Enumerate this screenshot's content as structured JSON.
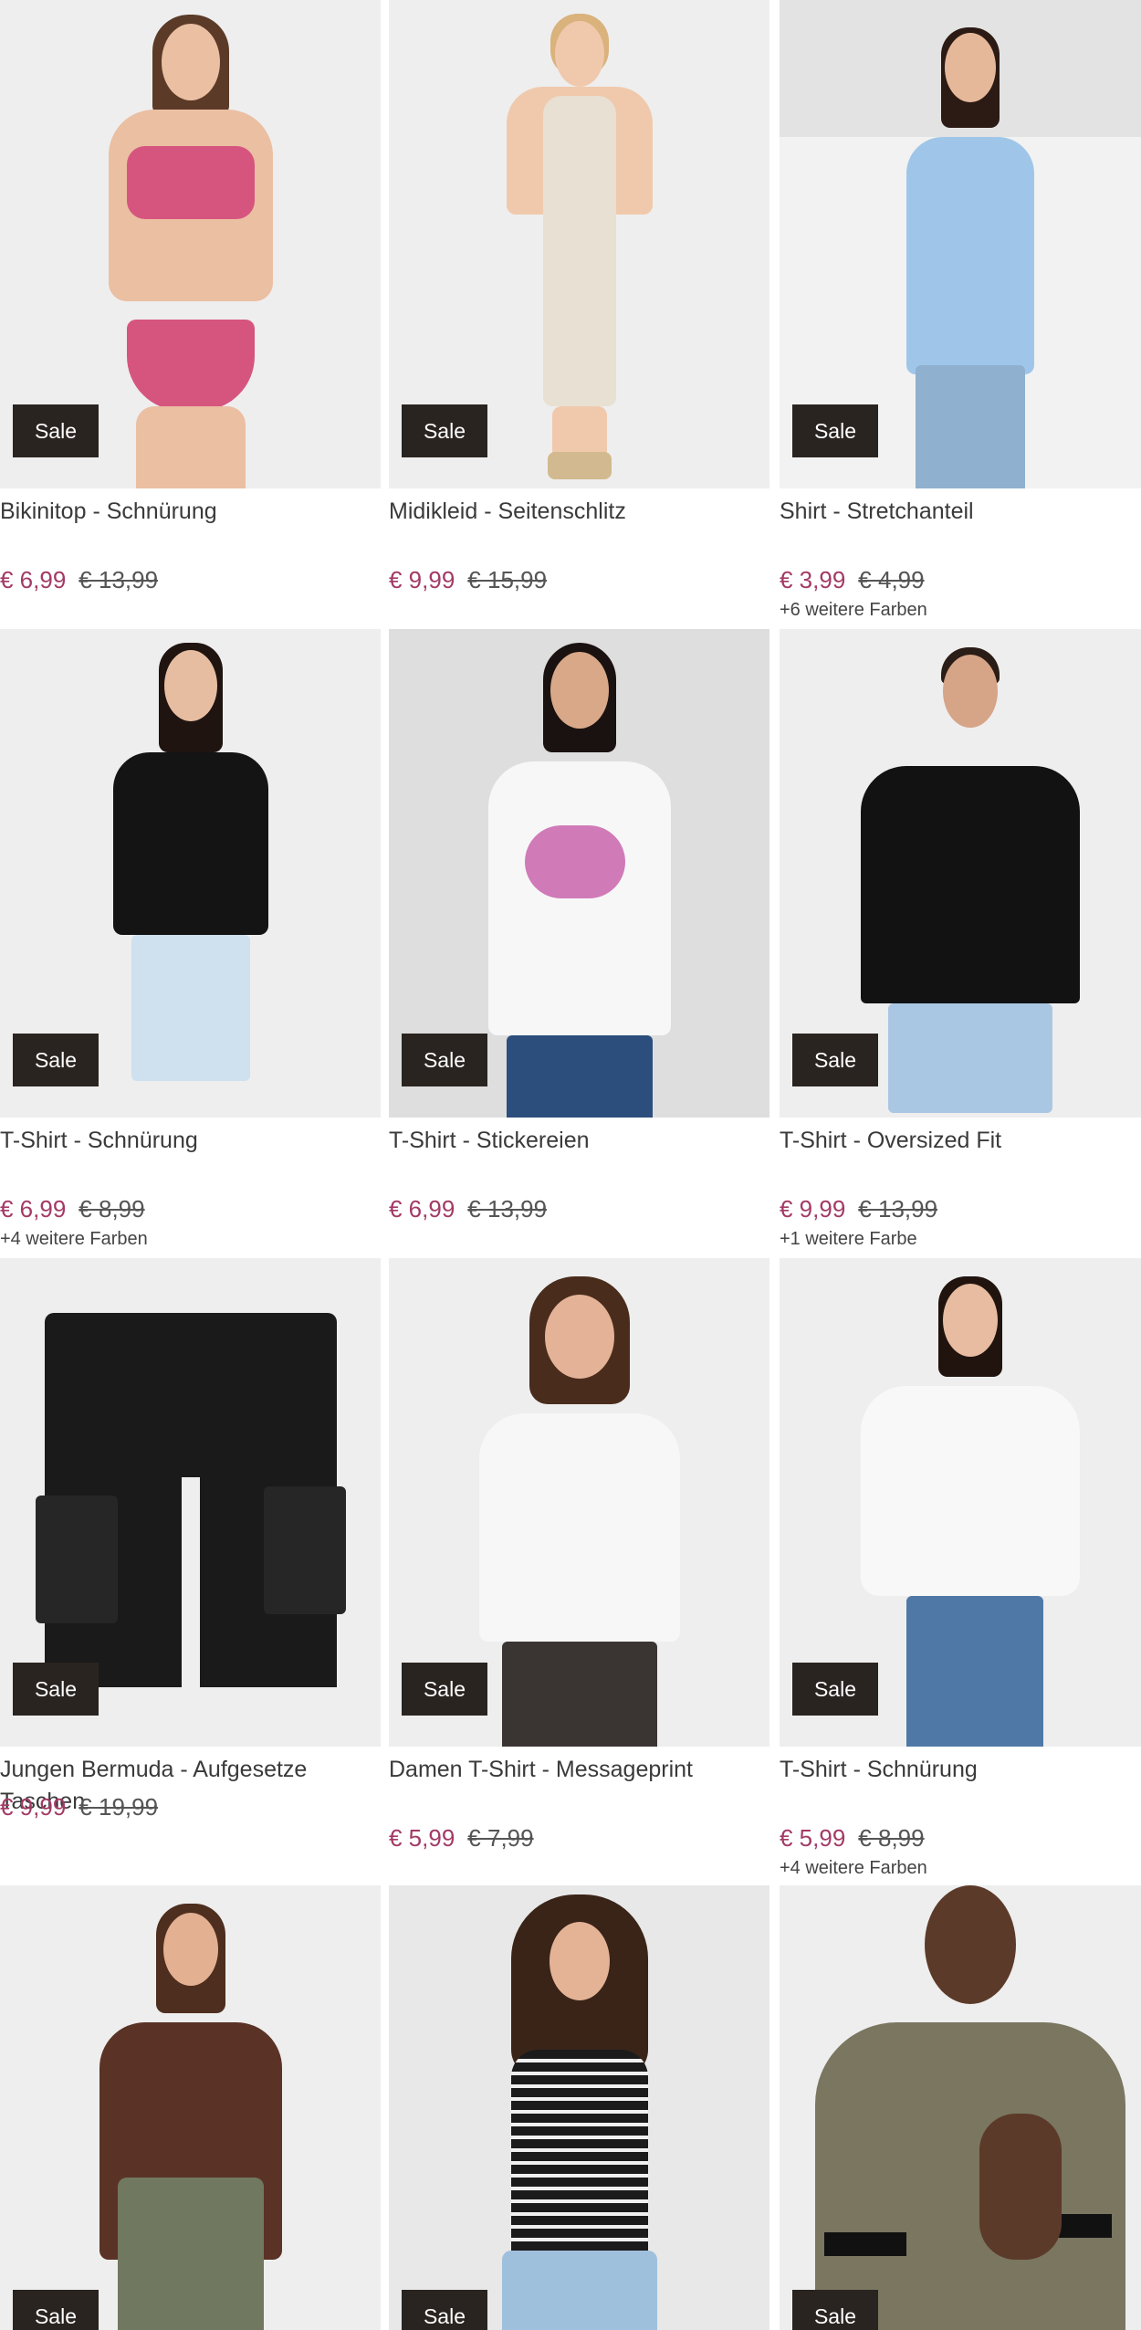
{
  "products": [
    {
      "title": "Bikinitop - Schnürung",
      "price": "€ 6,99",
      "old_price": "€ 13,99",
      "badge": "Sale",
      "colors": "",
      "garment_color": "#d6557f",
      "bottom_color": "#d6557f",
      "bg": "#e9e9e9"
    },
    {
      "title": "Midikleid - Seitenschlitz",
      "price": "€ 9,99",
      "old_price": "€ 15,99",
      "badge": "Sale",
      "colors": "",
      "garment_color": "#e8e0d2",
      "bottom_color": "#e8e0d2",
      "bg": "#eeeeee"
    },
    {
      "title": "Shirt - Stretchanteil",
      "price": "€ 3,99",
      "old_price": "€ 4,99",
      "badge": "Sale",
      "colors": "+6 weitere Farben",
      "garment_color": "#9fc6e8",
      "bottom_color": "#8fb0cf",
      "bg": "#f0f0f0"
    },
    {
      "title": "T-Shirt - Schnürung",
      "price": "€ 6,99",
      "old_price": "€ 8,99",
      "badge": "Sale",
      "colors": "+4 weitere Farben",
      "garment_color": "#141414",
      "bottom_color": "#cfe0ee",
      "bg": "#eeeeee"
    },
    {
      "title": "T-Shirt - Stickereien",
      "price": "€ 6,99",
      "old_price": "€ 13,99",
      "badge": "Sale",
      "colors": "",
      "garment_color": "#f7f7f7",
      "bottom_color": "#2c4e7c",
      "bg": "#d9d9d9"
    },
    {
      "title": "T-Shirt - Oversized Fit",
      "price": "€ 9,99",
      "old_price": "€ 13,99",
      "badge": "Sale",
      "colors": "+1 weitere Farbe",
      "garment_color": "#121212",
      "bottom_color": "#a9c7e3",
      "bg": "#eeeeee"
    },
    {
      "title": "Jungen Bermuda - Aufgesetze Taschen",
      "price": "€ 9,99",
      "old_price": "€ 19,99",
      "badge": "Sale",
      "colors": "",
      "garment_color": "#1a1a1a",
      "bottom_color": "#1a1a1a",
      "bg": "#eeeeee"
    },
    {
      "title": "Damen T-Shirt - Messageprint",
      "price": "€ 5,99",
      "old_price": "€ 7,99",
      "badge": "Sale",
      "colors": "",
      "garment_color": "#f7f7f7",
      "bottom_color": "#3a3533",
      "bg": "#eeeeee"
    },
    {
      "title": "T-Shirt - Schnürung",
      "price": "€ 5,99",
      "old_price": "€ 8,99",
      "badge": "Sale",
      "colors": "+4 weitere Farben",
      "garment_color": "#f8f8f8",
      "bottom_color": "#4f78a6",
      "bg": "#eeeeee"
    },
    {
      "title": "",
      "price": "",
      "old_price": "",
      "badge": "Sale",
      "colors": "",
      "garment_color": "#5a3326",
      "bottom_color": "#707860",
      "bg": "#eeeeee"
    },
    {
      "title": "",
      "price": "",
      "old_price": "",
      "badge": "Sale",
      "colors": "",
      "garment_color": "#1b1b1b",
      "bottom_color": "#9fc0dc",
      "bg": "#e8e8e8"
    },
    {
      "title": "",
      "price": "",
      "old_price": "",
      "badge": "Sale",
      "colors": "",
      "garment_color": "#7a7660",
      "bottom_color": "#7a7660",
      "bg": "#eeeeee"
    }
  ]
}
